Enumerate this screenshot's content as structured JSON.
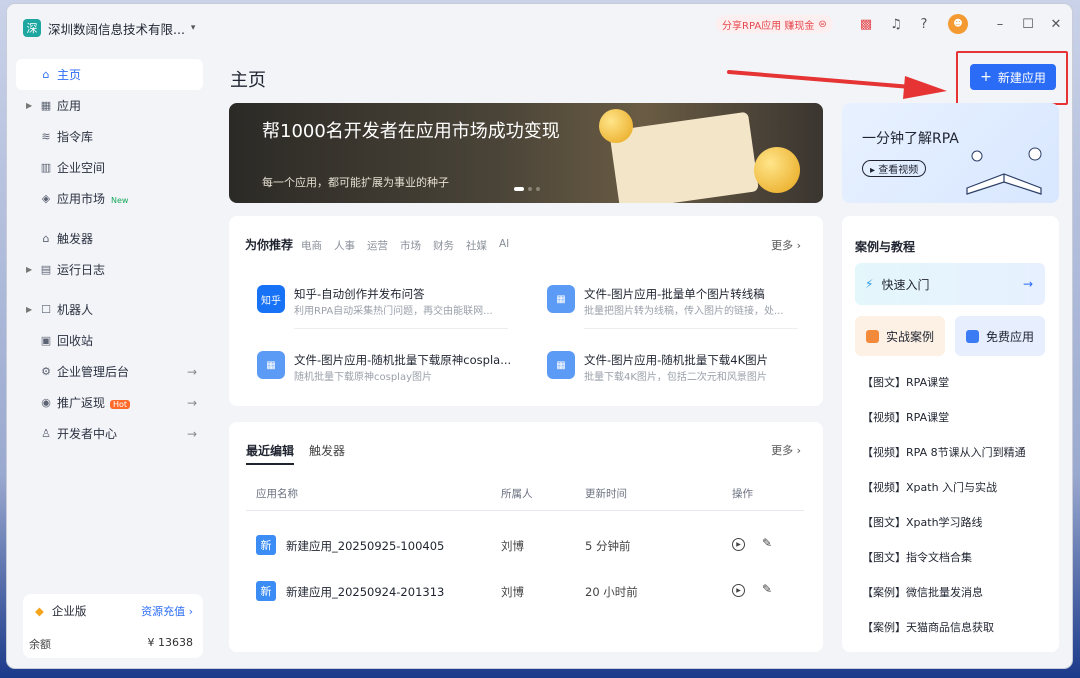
{
  "sidebar": {
    "org_logo": "深",
    "org_name": "深圳数阔信息技术有限...",
    "items": [
      {
        "label": "主页",
        "active": true
      },
      {
        "label": "应用"
      },
      {
        "label": "指令库"
      },
      {
        "label": "企业空间"
      },
      {
        "label": "应用市场",
        "tag": "New"
      },
      {
        "label": "触发器"
      },
      {
        "label": "运行日志"
      },
      {
        "label": "机器人"
      },
      {
        "label": "回收站"
      },
      {
        "label": "企业管理后台"
      },
      {
        "label": "推广返现",
        "tag": "Hot"
      },
      {
        "label": "开发者中心"
      }
    ],
    "enterprise": {
      "label": "企业版",
      "recharge": "资源充值 ›",
      "balance_label": "余额",
      "balance_value": "¥ 13638"
    }
  },
  "topbar": {
    "share": "分享RPA应用 赚现金"
  },
  "page": {
    "title": "主页",
    "new_app": "新建应用"
  },
  "banner": {
    "headline": "帮1000名开发者在应用市场成功变现",
    "sub": "每一个应用，都可能扩展为事业的种子"
  },
  "rpa_card": {
    "title": "一分钟了解RPA",
    "button": "▸ 查看视频"
  },
  "recommend": {
    "title": "为你推荐",
    "tabs": [
      "电商",
      "人事",
      "运营",
      "市场",
      "财务",
      "社媒",
      "AI"
    ],
    "more": "更多 ›",
    "apps": [
      {
        "icon": "知乎",
        "name": "知乎-自动创作并发布问答",
        "desc": "利用RPA自动采集热门问题，再交由能联网..."
      },
      {
        "icon": "",
        "name": "文件-图片应用-批量单个图片转线稿",
        "desc": "批量把图片转为线稿，传入图片的链接，处..."
      },
      {
        "icon": "",
        "name": "文件-图片应用-随机批量下载原神cospla...",
        "desc": "随机批量下载原神cosplay图片"
      },
      {
        "icon": "",
        "name": "文件-图片应用-随机批量下载4K图片",
        "desc": "批量下载4K图片，包括二次元和风景图片"
      }
    ]
  },
  "recent": {
    "tab_active": "最近编辑",
    "tab_other": "触发器",
    "more": "更多 ›",
    "columns": [
      "应用名称",
      "所属人",
      "更新时间",
      "操作"
    ],
    "rows": [
      {
        "icon": "新",
        "name": "新建应用_20250925-100405",
        "owner": "刘博",
        "time": "5 分钟前"
      },
      {
        "icon": "新",
        "name": "新建应用_20250924-201313",
        "owner": "刘博",
        "time": "20 小时前"
      }
    ]
  },
  "tutorials": {
    "title": "案例与教程",
    "quick": "快速入门",
    "case": "实战案例",
    "free": "免费应用",
    "links": [
      "【图文】RPA课堂",
      "【视频】RPA课堂",
      "【视频】RPA 8节课从入门到精通",
      "【视频】Xpath 入门与实战",
      "【图文】Xpath学习路线",
      "【图文】指令文档合集",
      "【案例】微信批量发消息",
      "【案例】天猫商品信息获取"
    ]
  },
  "colors": {
    "accent": "#2b6cf6",
    "annotation": "#e63333",
    "brand": "#1ea7a1"
  }
}
